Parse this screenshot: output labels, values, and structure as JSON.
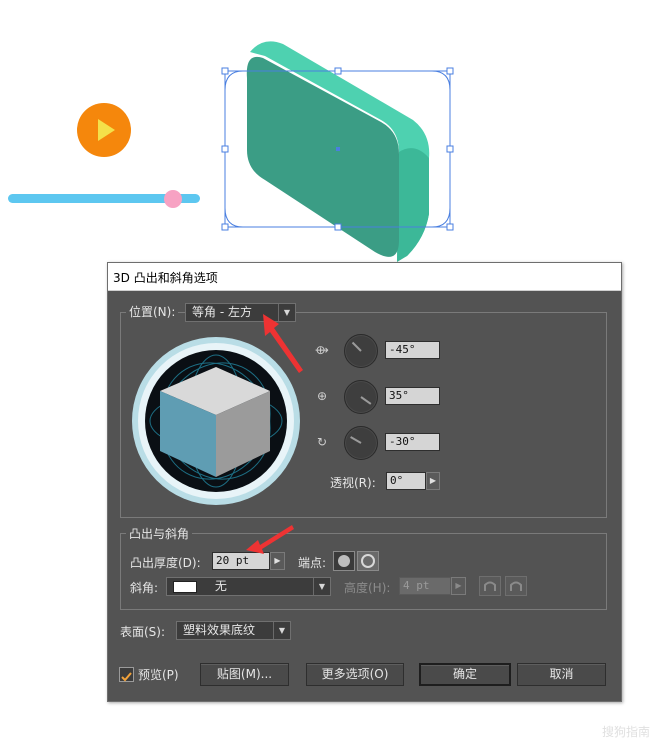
{
  "dialog": {
    "title": "3D 凸出和斜角选项",
    "position": {
      "label": "位置(N):",
      "value": "等角 - 左方",
      "x_angle": "-45°",
      "y_angle": "35°",
      "z_angle": "-30°",
      "perspective_label": "透视(R):",
      "perspective_value": "0°"
    },
    "extrude": {
      "group_label": "凸出与斜角",
      "depth_label": "凸出厚度(D):",
      "depth_value": "20 pt",
      "cap_label": "端点:",
      "bevel_label": "斜角:",
      "bevel_value": "无",
      "height_label": "高度(H):",
      "height_value": "4 pt"
    },
    "surface": {
      "label": "表面(S):",
      "value": "塑料效果底纹"
    },
    "buttons": {
      "preview_label": "预览(P)",
      "preview_checked": true,
      "map_label": "贴图(M)...",
      "more_label": "更多选项(O)",
      "ok_label": "确定",
      "cancel_label": "取消"
    }
  },
  "colors": {
    "dialog_bg": "#535353",
    "shape_front": "#3b9d85",
    "shape_side": "#4ed1b0",
    "play_button": "#f5870c",
    "slider_track": "#5dc7f0",
    "slider_thumb": "#f7a2c3",
    "selection_box": "#4a7fe0",
    "annotation_arrow": "#ee3333"
  },
  "icons": [
    "play-icon",
    "x-axis-rotate-icon",
    "y-axis-rotate-icon",
    "z-axis-rotate-icon",
    "cap-on-icon",
    "cap-off-icon",
    "bevel-in-icon",
    "bevel-out-icon",
    "checkbox-icon",
    "dropdown-arrow-icon"
  ],
  "watermark": "搜狗指南",
  "slider": {
    "value": 0.86
  }
}
